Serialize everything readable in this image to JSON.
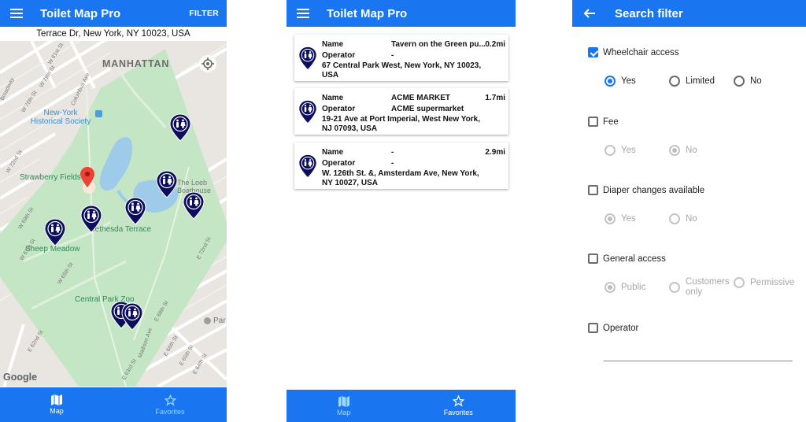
{
  "map_screen": {
    "title": "Toilet Map Pro",
    "filter_label": "FILTER",
    "address": "Terrace Dr, New York, NY 10023, USA",
    "map_labels": {
      "manhattan": "MANHATTAN",
      "nyhs": "New-York Historical Society",
      "strawberry": "Strawberry Fields",
      "loeb": "The Loeb Boathouse",
      "bethesda": "Bethesda Terrace",
      "sheep": "Sheep Meadow",
      "zoo": "Central Park Zoo",
      "par": "Par",
      "st81": "W 81st St",
      "st79": "W 79th St",
      "st76": "W 76th St",
      "colave": "Columbus Ave",
      "st72w": "W 72nd St",
      "st69": "W 69th St",
      "st67": "W 67th St",
      "st65": "W 65th St",
      "e72": "E 72nd St",
      "e68": "E 68th St",
      "e66": "E 66th St",
      "e65": "E 65th St",
      "e64": "E 64th St",
      "e63": "E 63rd St",
      "e62": "E 62nd St",
      "broadway": "Broadway",
      "madison": "Madison Ave"
    },
    "google": "Google",
    "nav": [
      {
        "label": "Map",
        "icon": "map-icon",
        "active": true
      },
      {
        "label": "Favorites",
        "icon": "star-icon",
        "active": false
      }
    ]
  },
  "favorites_screen": {
    "title": "Toilet Map Pro",
    "name_key": "Name",
    "operator_key": "Operator",
    "cards": [
      {
        "name": "Tavern on the Green pu...",
        "distance": "0.2mi",
        "operator": "-",
        "address": "67 Central Park West, New York, NY 10023, USA"
      },
      {
        "name": "ACME MARKET",
        "distance": "1.7mi",
        "operator": "ACME supermarket",
        "address": "19-21 Ave at Port Imperial, West New York, NJ 07093, USA"
      },
      {
        "name": "-",
        "distance": "2.9mi",
        "operator": "-",
        "address": "W. 126th St. &, Amsterdam Ave, New York, NY 10027, USA"
      }
    ],
    "nav": [
      {
        "label": "Map",
        "icon": "map-icon",
        "active": false
      },
      {
        "label": "Favorites",
        "icon": "star-icon",
        "active": true
      }
    ]
  },
  "filter_screen": {
    "title": "Search filter",
    "accent": "#1976f0",
    "sections": [
      {
        "label": "Wheelchair access",
        "checked": true,
        "options": [
          "Yes",
          "Limited",
          "No"
        ],
        "selected": "Yes"
      },
      {
        "label": "Fee",
        "checked": false,
        "options": [
          "Yes",
          "No"
        ],
        "selected": "No"
      },
      {
        "label": "Diaper changes available",
        "checked": false,
        "options": [
          "Yes",
          "No"
        ],
        "selected": "Yes"
      },
      {
        "label": "General access",
        "checked": false,
        "options": [
          "Public",
          "Customers only",
          "Permissive"
        ],
        "selected": "Public"
      },
      {
        "label": "Operator",
        "checked": false
      }
    ],
    "operator_value": ""
  },
  "colors": {
    "primary": "#1976f0",
    "nav_inactive": "#9fd7ff",
    "marker": "#0d0d5e",
    "park": "#c5e6c5",
    "water": "#9fcbea"
  }
}
